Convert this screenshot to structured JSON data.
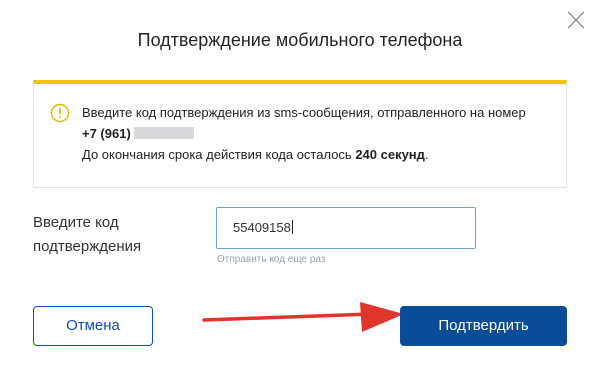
{
  "dialog": {
    "title": "Подтверждение мобильного телефона",
    "close_icon": "close-icon"
  },
  "notice": {
    "icon": "info-icon",
    "accent_color": "#f2c40e",
    "line1": "Введите код подтверждения из sms-сообщения, отправленного на номер",
    "phone_prefix": "+7 (961)",
    "line3_prefix": "До окончания срока действия кода осталось ",
    "seconds": "240 секунд",
    "line3_suffix": "."
  },
  "form": {
    "label_line1": "Введите код",
    "label_line2": "подтверждения",
    "code_value": "55409158",
    "resend_link": "Отправить код еще раз"
  },
  "buttons": {
    "cancel_label": "Отмена",
    "confirm_label": "Подтвердить",
    "cancel_color": "#0d4cd3",
    "confirm_color": "#0b4c98"
  },
  "annotation": {
    "arrow_color": "#e0352b"
  }
}
